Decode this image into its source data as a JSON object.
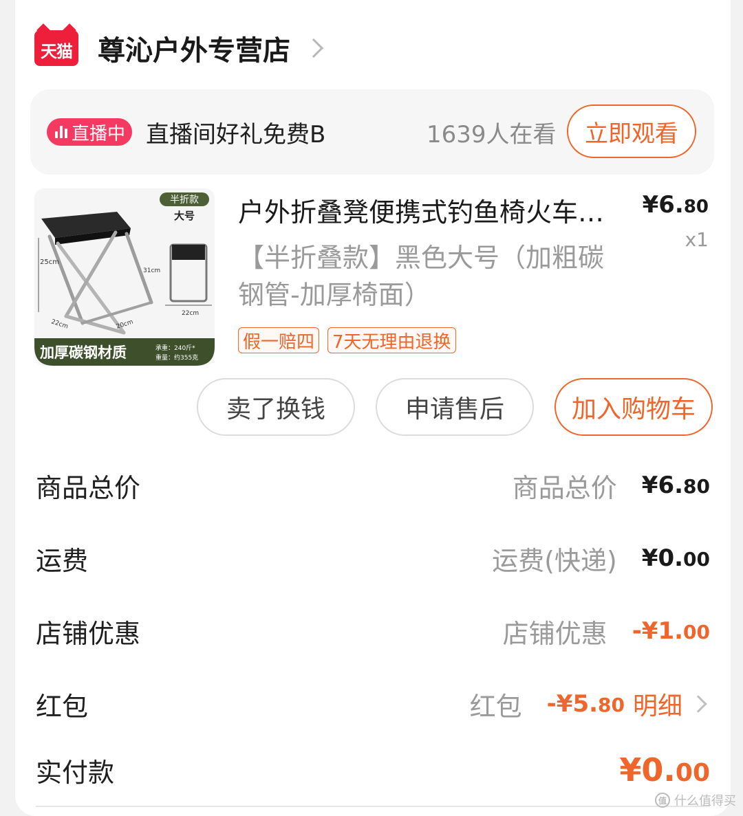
{
  "shop": {
    "logo_text": "天猫",
    "name": "尊沁户外专营店"
  },
  "live": {
    "badge": "直播中",
    "text": "直播间好礼免费B",
    "viewers": "1639人在看",
    "watch_button": "立即观看"
  },
  "product": {
    "title": "户外折叠凳便携式钓鱼椅火车…",
    "price_main": "¥6.",
    "price_decimal": "80",
    "quantity": "x1",
    "sku": "【半折叠款】黑色大号（加粗碳钢管-加厚椅面）",
    "tags": [
      "假一赔四",
      "7天无理由退换"
    ],
    "image": {
      "badge_top": "半折款",
      "badge_size": "大号",
      "dim_height": "25cm",
      "dim_seat": "31cm",
      "dim_width_a": "22cm",
      "dim_width_b": "20cm",
      "dim_folded": "22cm",
      "banner": "加厚碳钢材质",
      "load": "承重：240斤*",
      "weight": "重量：约355克"
    }
  },
  "actions": {
    "sell": "卖了换钱",
    "after_sale": "申请售后",
    "add_cart": "加入购物车"
  },
  "summary": {
    "total": {
      "label": "商品总价",
      "sub": "商品总价",
      "main": "¥6.",
      "decimal": "80"
    },
    "shipping": {
      "label": "运费",
      "sub": "运费(快递)",
      "main": "¥0.",
      "decimal": "00"
    },
    "shop_discount": {
      "label": "店铺优惠",
      "sub": "店铺优惠",
      "main": "-¥1.",
      "decimal": "00"
    },
    "red_packet": {
      "label": "红包",
      "sub": "红包",
      "main": "-¥5.",
      "decimal": "80",
      "detail": "明细"
    },
    "paid": {
      "label": "实付款",
      "main": "¥0.",
      "decimal": "00"
    }
  },
  "watermark": {
    "icon": "值",
    "text": "什么值得买"
  },
  "colors": {
    "accent": "#f0652a",
    "tmall_red": "#ee1f3b",
    "live_pink": "#f43a61",
    "muted": "#9a9a9a"
  }
}
